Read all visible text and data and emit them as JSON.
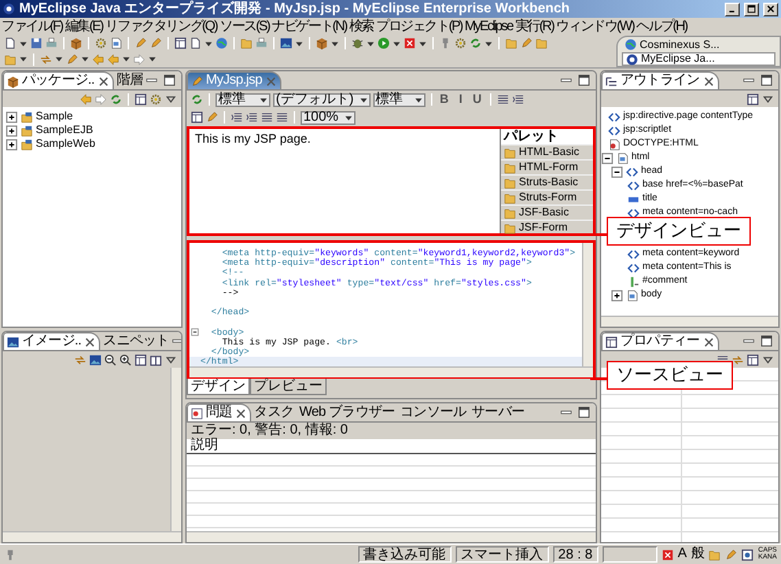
{
  "window": {
    "title": "MyEclipse Java エンタープライズ開発 - MyJsp.jsp - MyEclipse Enterprise Workbench"
  },
  "menu": [
    "ファイル(F)",
    "編集(E)",
    "リファクタリング(Q)",
    "ソース(S)",
    "ナビゲート(N)",
    "検索",
    "プロジェクト(P)",
    "MyEclipse",
    "実行(R)",
    "ウィンドウ(W)",
    "ヘルプ(H)"
  ],
  "perspectives": [
    {
      "label": "Cosminexus S...",
      "selected": false
    },
    {
      "label": "MyEclipse Ja...",
      "selected": true
    }
  ],
  "package_explorer": {
    "tabs": [
      {
        "label": "パッケージ..",
        "selected": true
      },
      {
        "label": "階層",
        "selected": false
      }
    ],
    "items": [
      {
        "label": "Sample",
        "expanded": false
      },
      {
        "label": "SampleEJB",
        "expanded": false
      },
      {
        "label": "SampleWeb",
        "expanded": false
      }
    ]
  },
  "image_view": {
    "tabs": [
      {
        "label": "イメージ..",
        "selected": true
      },
      {
        "label": "スニペット",
        "selected": false
      }
    ]
  },
  "editor": {
    "tab": "MyJsp.jsp",
    "style": "標準",
    "font": "(デフォルト)",
    "size": "標準",
    "format_buttons": [
      "B",
      "I",
      "U"
    ],
    "zoom": "100%",
    "design_text": "This is my JSP page.",
    "palette": {
      "title": "パレット",
      "items": [
        "HTML-Basic",
        "HTML-Form",
        "Struts-Basic",
        "Struts-Form",
        "JSF-Basic",
        "JSF-Form"
      ]
    },
    "source_lines": [
      {
        "text": "    <meta http-equiv=\"keywords\" content=\"keyword1,keyword2,keyword3\">",
        "current": false
      },
      {
        "text": "    <meta http-equiv=\"description\" content=\"This is my page\">",
        "current": false
      },
      {
        "text": "    <!--",
        "current": false
      },
      {
        "text": "    <link rel=\"stylesheet\" type=\"text/css\" href=\"styles.css\">",
        "current": false
      },
      {
        "text": "    -->",
        "current": false
      },
      {
        "text": "  </head>",
        "current": false,
        "space_before": true
      },
      {
        "text": "  <body>",
        "current": false,
        "space_before": true,
        "fold_marker": true
      },
      {
        "text": "    This is my JSP page. <br>",
        "current": false
      },
      {
        "text": "  </body>",
        "current": false
      },
      {
        "text": "</html>",
        "current": true
      }
    ],
    "view_tabs": [
      {
        "label": "デザイン",
        "selected": true
      },
      {
        "label": "プレビュー",
        "selected": false
      }
    ]
  },
  "problems": {
    "tabs": [
      {
        "label": "問題",
        "selected": true
      },
      {
        "label": "タスク",
        "selected": false
      },
      {
        "label": "Web ブラウザー",
        "selected": false
      },
      {
        "label": "コンソール",
        "selected": false
      },
      {
        "label": "サーバー",
        "selected": false
      }
    ],
    "summary": "エラー: 0, 警告: 0, 情報: 0",
    "columns": [
      "説明"
    ]
  },
  "outline": {
    "tab": "アウトライン",
    "items": [
      {
        "kind": "tag",
        "label": "jsp:directive.page contentType"
      },
      {
        "kind": "tag",
        "label": "jsp:scriptlet"
      },
      {
        "kind": "doctype",
        "label": "DOCTYPE:HTML"
      },
      {
        "kind": "page",
        "label": "html",
        "expanded": true,
        "children": [
          {
            "kind": "tag",
            "label": "head",
            "expanded": true,
            "children": [
              {
                "kind": "tag",
                "label": "base href=<%=basePat"
              },
              {
                "kind": "title",
                "label": "title"
              },
              {
                "kind": "tag",
                "label": "meta content=no-cach",
                "gap_after": true
              },
              {
                "kind": "tag",
                "label": "meta content=keyword"
              },
              {
                "kind": "tag",
                "label": "meta content=This is"
              },
              {
                "kind": "comment",
                "label": "#comment"
              }
            ]
          },
          {
            "kind": "page",
            "label": "body",
            "expanded": false
          }
        ]
      }
    ]
  },
  "properties": {
    "tab": "プロパティー"
  },
  "callouts": [
    {
      "text": "デザインビュー"
    },
    {
      "text": "ソースビュー"
    }
  ],
  "status_bar": {
    "mode": "書き込み可能",
    "insert": "スマート挿入",
    "position": "28 : 8",
    "ime_mode": "A",
    "ime_conv": "般",
    "keys": [
      "CAPS",
      "KANA"
    ]
  }
}
